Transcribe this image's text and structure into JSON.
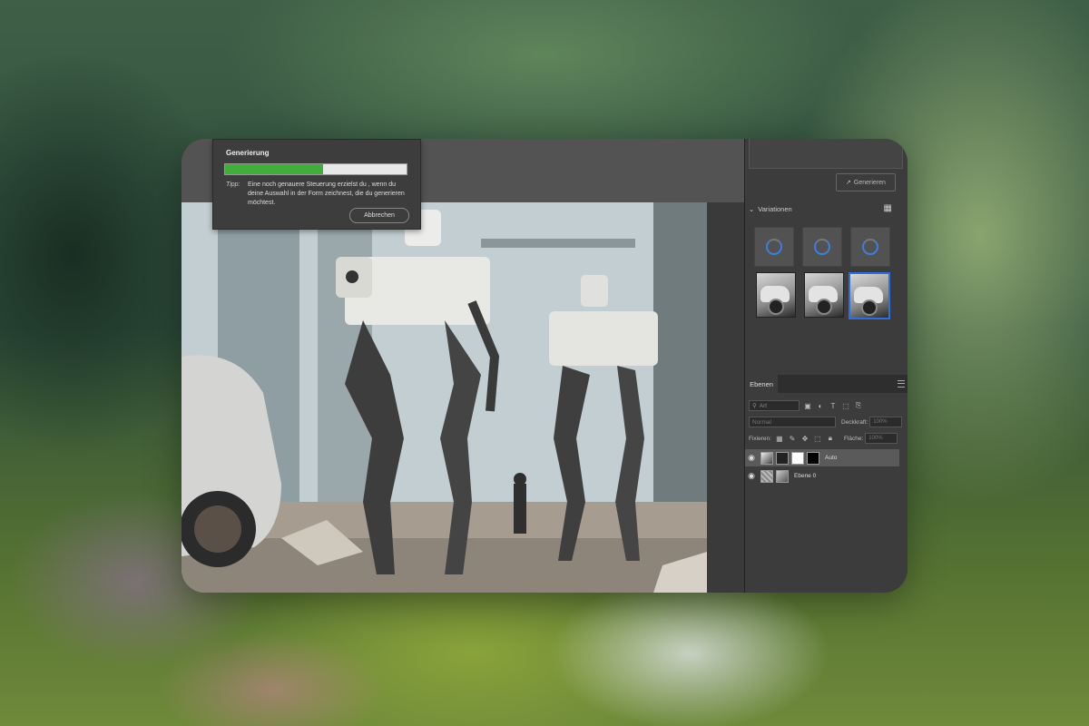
{
  "popup": {
    "title": "Generierung",
    "progress": 0.54,
    "tip_label": "Tipp:",
    "tip_text": "Eine noch genauere Steuerung erzielst du , wenn du deine Auswahl in der Form zeichnest, die du generieren möchtest.",
    "cancel_label": "Abbrechen"
  },
  "right_panel": {
    "generate_label": "Generieren",
    "variations_label": "Variationen",
    "variations": [
      {
        "state": "loading"
      },
      {
        "state": "loading"
      },
      {
        "state": "loading"
      },
      {
        "state": "image"
      },
      {
        "state": "image"
      },
      {
        "state": "image",
        "selected": true
      }
    ]
  },
  "layers": {
    "tab_label": "Ebenen",
    "filter_placeholder": "Art",
    "blend_mode": "Normal",
    "opacity_label": "Deckkraft:",
    "opacity_value": "100%",
    "lock_label": "Fixieren:",
    "fill_label": "Fläche:",
    "fill_value": "100%",
    "items": [
      {
        "name": "Auto",
        "selected": true
      },
      {
        "name": "Ebene 0",
        "selected": false
      }
    ]
  },
  "colors": {
    "progress_fill": "#3fae3a",
    "selection_accent": "#2f6fdd",
    "spinner_accent": "#3d7ee0"
  }
}
